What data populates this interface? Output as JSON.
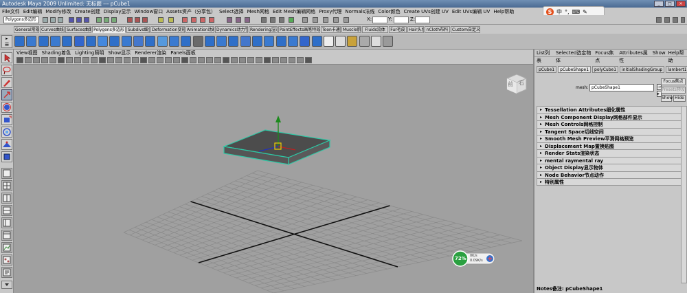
{
  "window": {
    "title": "Autodesk Maya 2009 Unlimited: 无标题   ---   pCube1"
  },
  "menubar": {
    "items": [
      "File文件",
      "Edit编辑",
      "Modify修改",
      "Create创建",
      "Display显示",
      "Window窗口",
      "Assets资产（分享包）",
      "Select选择",
      "Mesh网格",
      "Edit Mesh编辑网格",
      "Proxy代理",
      "Normals法线",
      "Color颜色",
      "Create UVs创建 UV",
      "Edit UVs编辑 UV",
      "Help帮助"
    ]
  },
  "ime": {
    "logo": "S",
    "label": "中"
  },
  "statusline": {
    "mode": "Polygons多边形",
    "x_label": "X:",
    "y_label": "Y:",
    "z_label": "Z:"
  },
  "shelf": {
    "tabs": [
      "General常规",
      "Curves曲线",
      "Surfaces曲面",
      "Polygons多边形",
      "Subdivs细分",
      "Deformation变形",
      "Animation动画",
      "Dynamics动力学",
      "Rendering渲染",
      "PaintEffects画笔特效",
      "Toon卡通",
      "Muscle肌肉",
      "Fluids流体",
      "Fur毛皮",
      "Hair头发",
      "nCloth布料",
      "Custom自定义"
    ],
    "active_tab": "Polygons多边形",
    "icon_count": 32
  },
  "panel": {
    "menu": [
      "View视图",
      "Shading着色",
      "Lighting照明",
      "Show显示",
      "Renderer渲染",
      "Panels面板"
    ]
  },
  "viewport": {
    "viewcube": {
      "front": "前",
      "right": "右"
    },
    "fps": {
      "percent": "72%",
      "value1": "0K/s",
      "value2": "0.09K/s"
    }
  },
  "attribute_editor": {
    "menu": [
      "List列表",
      "Selected选定物体",
      "Focus焦点",
      "Attributes属性",
      "Show",
      "Help帮助"
    ],
    "tabs": [
      "pCube1",
      "pCubeShape1",
      "polyCube1",
      "initialShadingGroup",
      "lambert1"
    ],
    "active_tab": "pCubeShape1",
    "mesh_label": "mesh:",
    "mesh_value": "pCubeShape1",
    "focus_btn": "Focus焦点",
    "presets_btn": "Presets预设",
    "show_btn": "Show",
    "hide_btn": "Hide",
    "sections": [
      "Tessellation Attributes细化属性",
      "Mesh Component Display网格部件显示",
      "Mesh Controls网格控制",
      "Tangent Space切线空间",
      "Smooth Mesh Preview平滑网格预览",
      "Displacement Map置换贴图",
      "Render Stats渲染状态",
      "mental raymental ray",
      "Object Display显示物体",
      "Node Behavior节点动作",
      "特别属性"
    ],
    "notes": "Notes备注: pCubeShape1"
  },
  "colors": {
    "viewport_bg": "#a0a0a0",
    "grid": "#8a8a8a",
    "cube_wire": "#2ec9a6",
    "cube_face": "#4c4c4c",
    "axis_green": "#1c8a1c",
    "pivot": "#f0d000"
  }
}
